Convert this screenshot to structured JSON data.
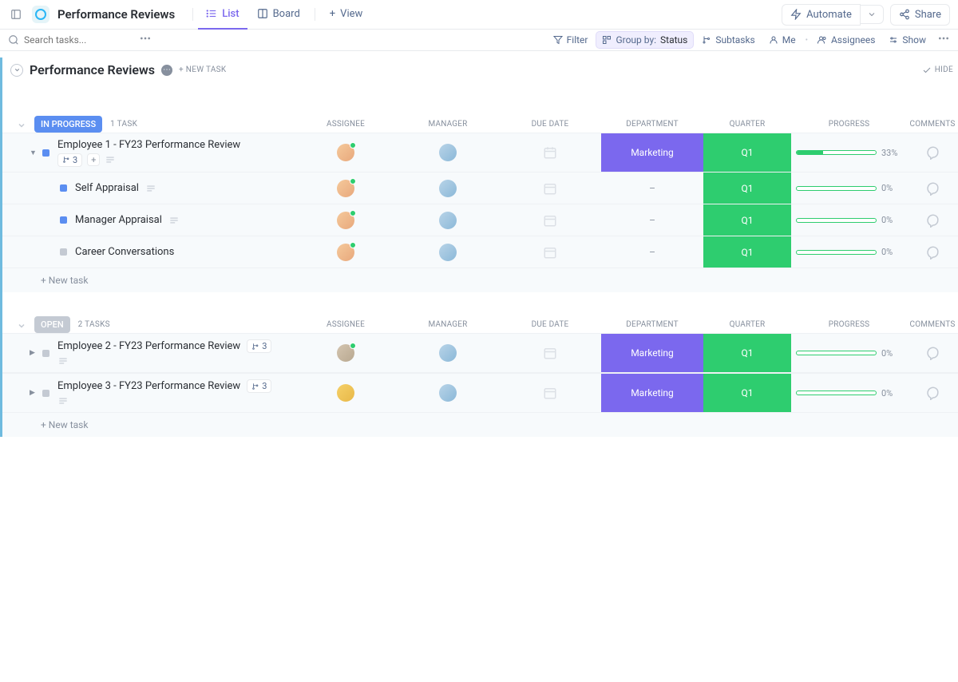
{
  "header": {
    "title": "Performance Reviews",
    "tabs": {
      "list": "List",
      "board": "Board",
      "view": "View"
    },
    "automate": "Automate",
    "share": "Share"
  },
  "toolbar": {
    "search_placeholder": "Search tasks...",
    "filter": "Filter",
    "group_by_label": "Group by:",
    "group_by_value": "Status",
    "subtasks": "Subtasks",
    "me": "Me",
    "assignees": "Assignees",
    "show": "Show"
  },
  "list": {
    "name": "Performance Reviews",
    "new_task_link": "+ NEW TASK",
    "hide": "HIDE",
    "new_task_row": "+ New task"
  },
  "columns": {
    "assignee": "ASSIGNEE",
    "manager": "MANAGER",
    "due_date": "DUE DATE",
    "department": "DEPARTMENT",
    "quarter": "QUARTER",
    "progress": "PROGRESS",
    "comments": "COMMENTS"
  },
  "departments": {
    "marketing": "Marketing"
  },
  "quarters": {
    "q1": "Q1"
  },
  "groups": [
    {
      "status": "IN PROGRESS",
      "count_label": "1 TASK",
      "tasks": [
        {
          "title": "Employee 1 - FY23 Performance Review",
          "sub_count": "3",
          "progress": 33,
          "progress_label": "33%",
          "has_subs": true,
          "assignee": "a1",
          "manager": "a2",
          "subtasks": [
            {
              "title": "Self Appraisal",
              "status": "blue",
              "progress_label": "0%"
            },
            {
              "title": "Manager Appraisal",
              "status": "blue",
              "progress_label": "0%"
            },
            {
              "title": "Career Conversations",
              "status": "gray",
              "progress_label": "0%"
            }
          ]
        }
      ]
    },
    {
      "status": "OPEN",
      "count_label": "2 TASKS",
      "tasks": [
        {
          "title": "Employee 2 - FY23 Performance Review",
          "sub_count": "3",
          "progress": 0,
          "progress_label": "0%",
          "assignee": "a3",
          "manager": "a2"
        },
        {
          "title": "Employee 3 - FY23 Performance Review",
          "sub_count": "3",
          "progress": 0,
          "progress_label": "0%",
          "assignee": "a4",
          "manager": "a2"
        }
      ]
    }
  ]
}
